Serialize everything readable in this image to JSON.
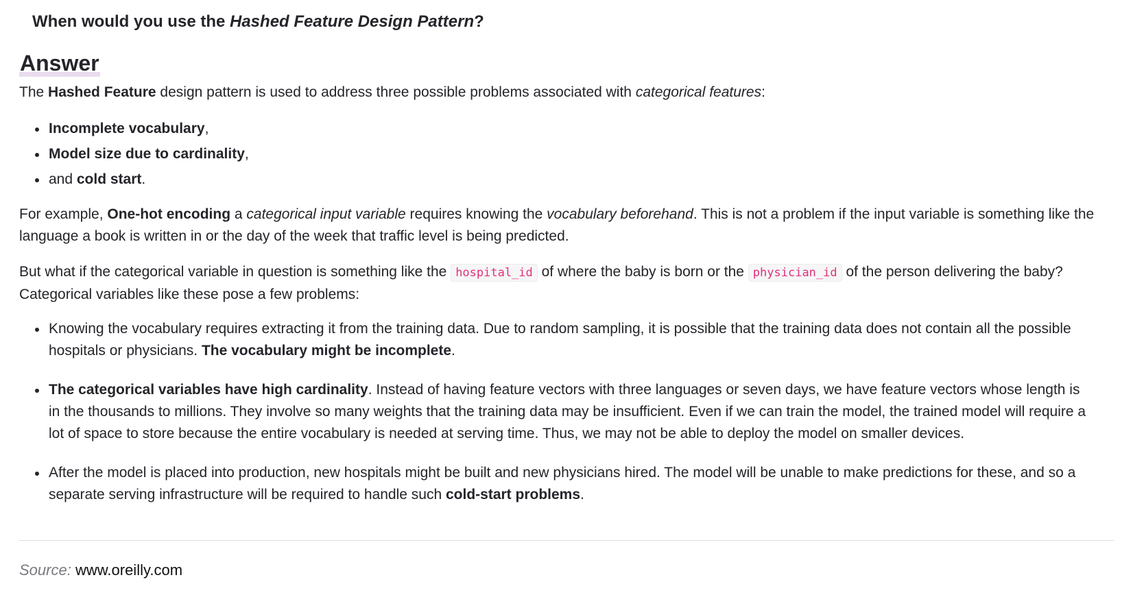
{
  "question": {
    "prefix": "When would you use the ",
    "pattern_name": "Hashed Feature Design Pattern",
    "suffix": "?"
  },
  "answer_heading": "Answer",
  "intro": {
    "t1": "The ",
    "b1": "Hashed Feature",
    "t2": " design pattern is used to address three possible problems associated with ",
    "i1": "categorical features",
    "t3": ":"
  },
  "problems": [
    {
      "pre": "",
      "bold": "Incomplete vocabulary",
      "post": ","
    },
    {
      "pre": "",
      "bold": "Model size due to cardinality",
      "post": ","
    },
    {
      "pre": "and ",
      "bold": "cold start",
      "post": "."
    }
  ],
  "example": {
    "t1": "For example, ",
    "b1": "One-hot encoding",
    "t2": " a ",
    "i1": "categorical input variable",
    "t3": " requires knowing the ",
    "i2": "vocabulary beforehand",
    "t4": ". This is not a problem if the input variable is something like the language a book is written in or the day of the week that traffic level is being predicted."
  },
  "question_para": {
    "t1": "But what if the categorical variable in question is something like the ",
    "code1": "hospital_id",
    "t2": " of where the baby is born or the ",
    "code2": "physician_id",
    "t3": " of the person delivering the baby? Categorical variables like these pose a few problems:"
  },
  "issues": [
    {
      "t1": "Knowing the vocabulary requires extracting it from the training data. Due to random sampling, it is possible that the training data does not contain all the possible hospitals or physicians. ",
      "b1": "The vocabulary might be incomplete",
      "t2": "."
    },
    {
      "b1": "The categorical variables have high cardinality",
      "t1": ". Instead of having feature vectors with three languages or seven days, we have feature vectors whose length is in the thousands to millions. They involve so many weights that the training data may be insufficient. Even if we can train the model, the trained model will require a lot of space to store because the entire vocabulary is needed at serving time. Thus, we may not be able to deploy the model on smaller devices."
    },
    {
      "t1": "After the model is placed into production, new hospitals might be built and new physicians hired. The model will be unable to make predictions for these, and so a separate serving infrastructure will be required to handle such ",
      "b1": "cold-start problems",
      "t2": "."
    }
  ],
  "source": {
    "label": "Source:",
    "url": "www.oreilly.com"
  }
}
